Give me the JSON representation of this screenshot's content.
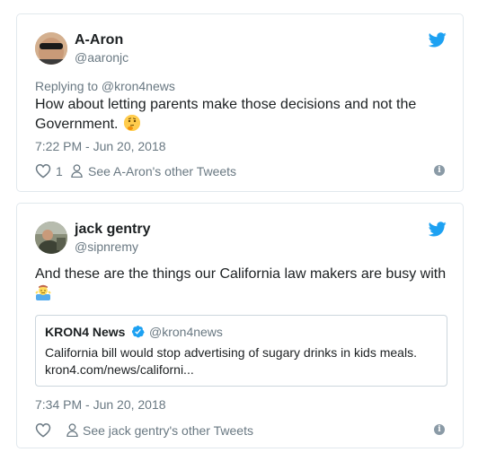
{
  "tweets": [
    {
      "author_name": "A-Aron",
      "author_handle": "@aaronjc",
      "reply_to": "Replying to @kron4news",
      "text": "How about letting parents make those decisions and not the Government.",
      "emoji": "thinking-face",
      "timestamp": "7:22 PM - Jun 20, 2018",
      "like_count": "1",
      "other_tweets_label": "See A-Aron's other Tweets"
    },
    {
      "author_name": "jack gentry",
      "author_handle": "@sipnremy",
      "text": "And these are the things our California law makers are busy with",
      "emoji": "man-shrugging",
      "quote": {
        "name": "KRON4 News",
        "handle": "@kron4news",
        "text": "California bill would stop advertising of sugary drinks in kids meals. kron4.com/news/californi..."
      },
      "timestamp": "7:34 PM - Jun 20, 2018",
      "other_tweets_label": "See jack gentry's other Tweets"
    }
  ],
  "icons": {
    "bird": "twitter-bird-icon",
    "heart": "heart-icon",
    "person": "person-icon",
    "info": "info-icon",
    "verified": "verified-badge-icon"
  },
  "colors": {
    "twitter_blue": "#1da1f2",
    "secondary_text": "#697882",
    "border": "#e1e8ed"
  }
}
